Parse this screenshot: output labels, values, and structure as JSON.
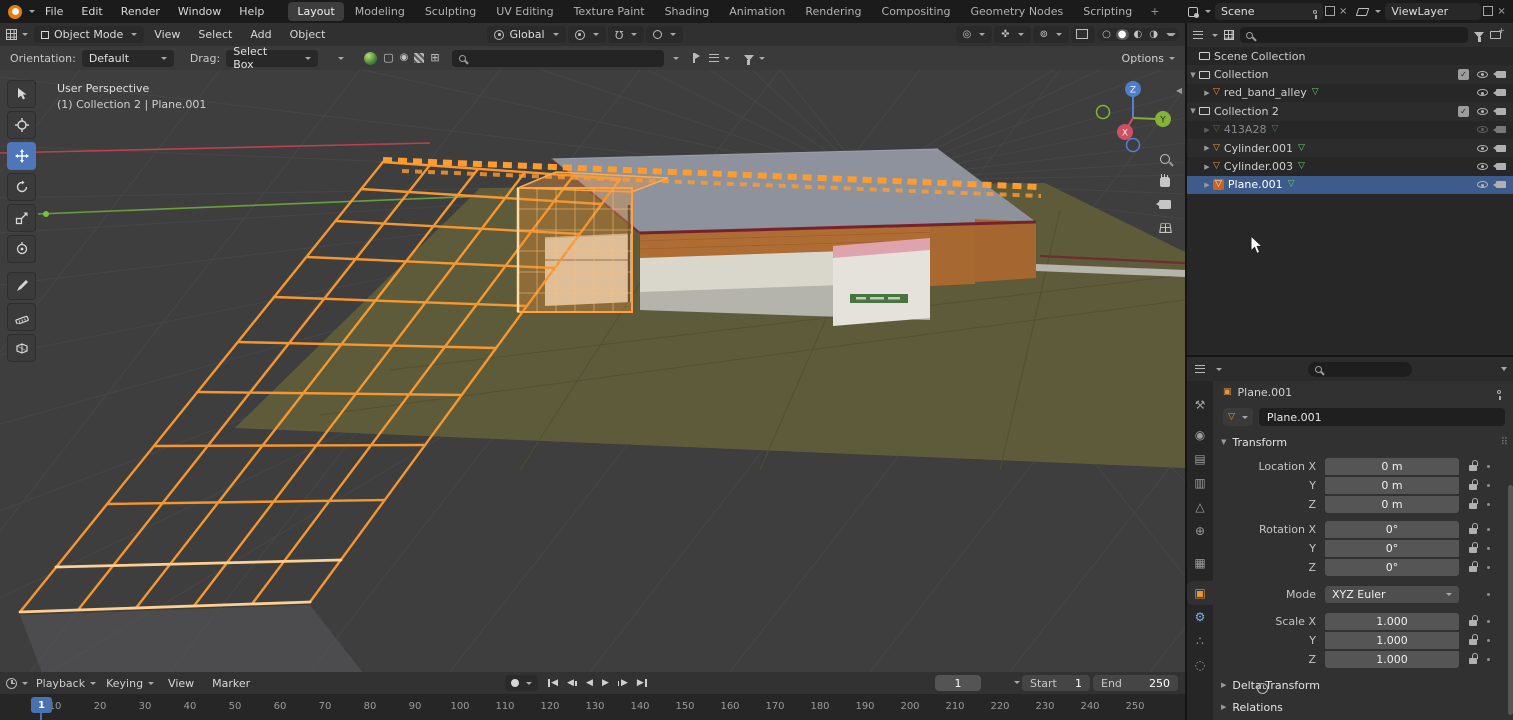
{
  "topbar": {
    "menus": [
      "File",
      "Edit",
      "Render",
      "Window",
      "Help"
    ],
    "workspaces": [
      "Layout",
      "Modeling",
      "Sculpting",
      "UV Editing",
      "Texture Paint",
      "Shading",
      "Animation",
      "Rendering",
      "Compositing",
      "Geometry Nodes",
      "Scripting"
    ],
    "add_workspace": "+",
    "scene_label": "Scene",
    "viewlayer_label": "ViewLayer"
  },
  "viewport_header": {
    "mode": "Object Mode",
    "menus": [
      "View",
      "Select",
      "Add",
      "Object"
    ],
    "orientation": "Global"
  },
  "tool_settings": {
    "orientation_label": "Orientation:",
    "orientation_value": "Default",
    "drag_label": "Drag:",
    "drag_value": "Select Box",
    "options": "Options"
  },
  "viewport": {
    "view_label": "User Perspective",
    "context_label": "(1) Collection 2 | Plane.001",
    "axis_x": "X",
    "axis_y": "Y",
    "axis_z": "Z"
  },
  "outliner": {
    "root_label": "Scene Collection",
    "items": [
      {
        "label": "Collection"
      },
      {
        "label": "red_band_alley"
      },
      {
        "label": "Collection 2"
      },
      {
        "label": "413A28"
      },
      {
        "label": "Cylinder.001"
      },
      {
        "label": "Cylinder.003"
      },
      {
        "label": "Plane.001"
      }
    ]
  },
  "properties": {
    "breadcrumb": "Plane.001",
    "object_name": "Plane.001",
    "transform_title": "Transform",
    "rows": [
      {
        "label": "Location X",
        "value": "0 m"
      },
      {
        "label": "Y",
        "value": "0 m"
      },
      {
        "label": "Z",
        "value": "0 m"
      },
      {
        "label": "Rotation X",
        "value": "0°"
      },
      {
        "label": "Y",
        "value": "0°"
      },
      {
        "label": "Z",
        "value": "0°"
      },
      {
        "label": "Mode",
        "value": "XYZ Euler"
      },
      {
        "label": "Scale X",
        "value": "1.000"
      },
      {
        "label": "Y",
        "value": "1.000"
      },
      {
        "label": "Z",
        "value": "1.000"
      }
    ],
    "delta_transform_title": "Delta Transform",
    "relations_title": "Relations"
  },
  "timeline": {
    "menus": [
      "Playback",
      "Keying",
      "View",
      "Marker"
    ],
    "current_frame": "1",
    "start_label": "Start",
    "start_value": "1",
    "end_label": "End",
    "end_value": "250",
    "ticks": [
      "1",
      "10",
      "20",
      "30",
      "40",
      "50",
      "60",
      "70",
      "80",
      "90",
      "100",
      "110",
      "120",
      "130",
      "140",
      "150",
      "160",
      "170",
      "180",
      "190",
      "200",
      "210",
      "220",
      "230",
      "240",
      "250"
    ]
  }
}
